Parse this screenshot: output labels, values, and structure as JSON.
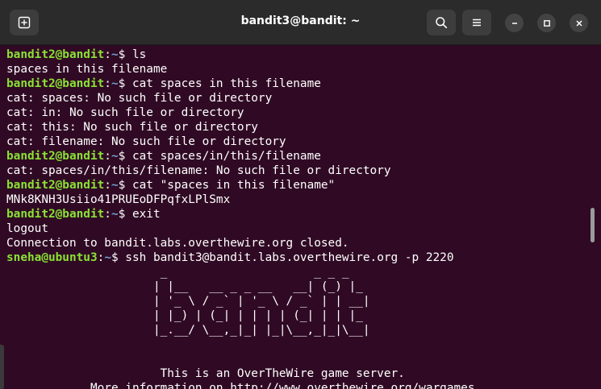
{
  "window": {
    "title": "bandit3@bandit: ~"
  },
  "icons": {
    "new_tab": "new-tab-icon",
    "search": "search-icon",
    "menu": "hamburger-menu-icon",
    "minimize": "minimize-icon",
    "maximize": "maximize-icon",
    "close": "close-icon"
  },
  "colors": {
    "terminal_bg": "#300a24",
    "titlebar_bg": "#2b2b2b",
    "prompt_user": "#8ae234",
    "prompt_path": "#729fcf",
    "text": "#ffffff"
  },
  "terminal": {
    "lines": [
      {
        "user": "bandit2@bandit",
        "sep": ":",
        "path": "~",
        "cmd": "$ ls"
      },
      {
        "text": "spaces in this filename"
      },
      {
        "user": "bandit2@bandit",
        "sep": ":",
        "path": "~",
        "cmd": "$ cat spaces in this filename"
      },
      {
        "text": "cat: spaces: No such file or directory"
      },
      {
        "text": "cat: in: No such file or directory"
      },
      {
        "text": "cat: this: No such file or directory"
      },
      {
        "text": "cat: filename: No such file or directory"
      },
      {
        "user": "bandit2@bandit",
        "sep": ":",
        "path": "~",
        "cmd": "$ cat spaces/in/this/filename"
      },
      {
        "text": "cat: spaces/in/this/filename: No such file or directory"
      },
      {
        "user": "bandit2@bandit",
        "sep": ":",
        "path": "~",
        "cmd": "$ cat \"spaces in this filename\""
      },
      {
        "text": "MNk8KNH3Usiio41PRUEoDFPqfxLPlSmx"
      },
      {
        "user": "bandit2@bandit",
        "sep": ":",
        "path": "~",
        "cmd": "$ exit"
      },
      {
        "text": "logout"
      },
      {
        "text": "Connection to bandit.labs.overthewire.org closed."
      },
      {
        "user": "sneha@ubuntu3",
        "sep": ":",
        "path": "~",
        "cmd": "$ ssh bandit3@bandit.labs.overthewire.org -p 2220"
      },
      {
        "text": "                      _                     _ _ _"
      },
      {
        "text": "                     | |__   __ _ _ __   __| (_) |_"
      },
      {
        "text": "                     | '_ \\ / _` | '_ \\ / _` | | __|"
      },
      {
        "text": "                     | |_) | (_| | | | | (_| | | |_"
      },
      {
        "text": "                     |_.__/ \\__,_|_| |_|\\__,_|_|\\__|"
      },
      {
        "text": ""
      },
      {
        "text": ""
      },
      {
        "text": "                      This is an OverTheWire game server."
      },
      {
        "text": "            More information on http://www.overthewire.org/wargames"
      }
    ]
  }
}
